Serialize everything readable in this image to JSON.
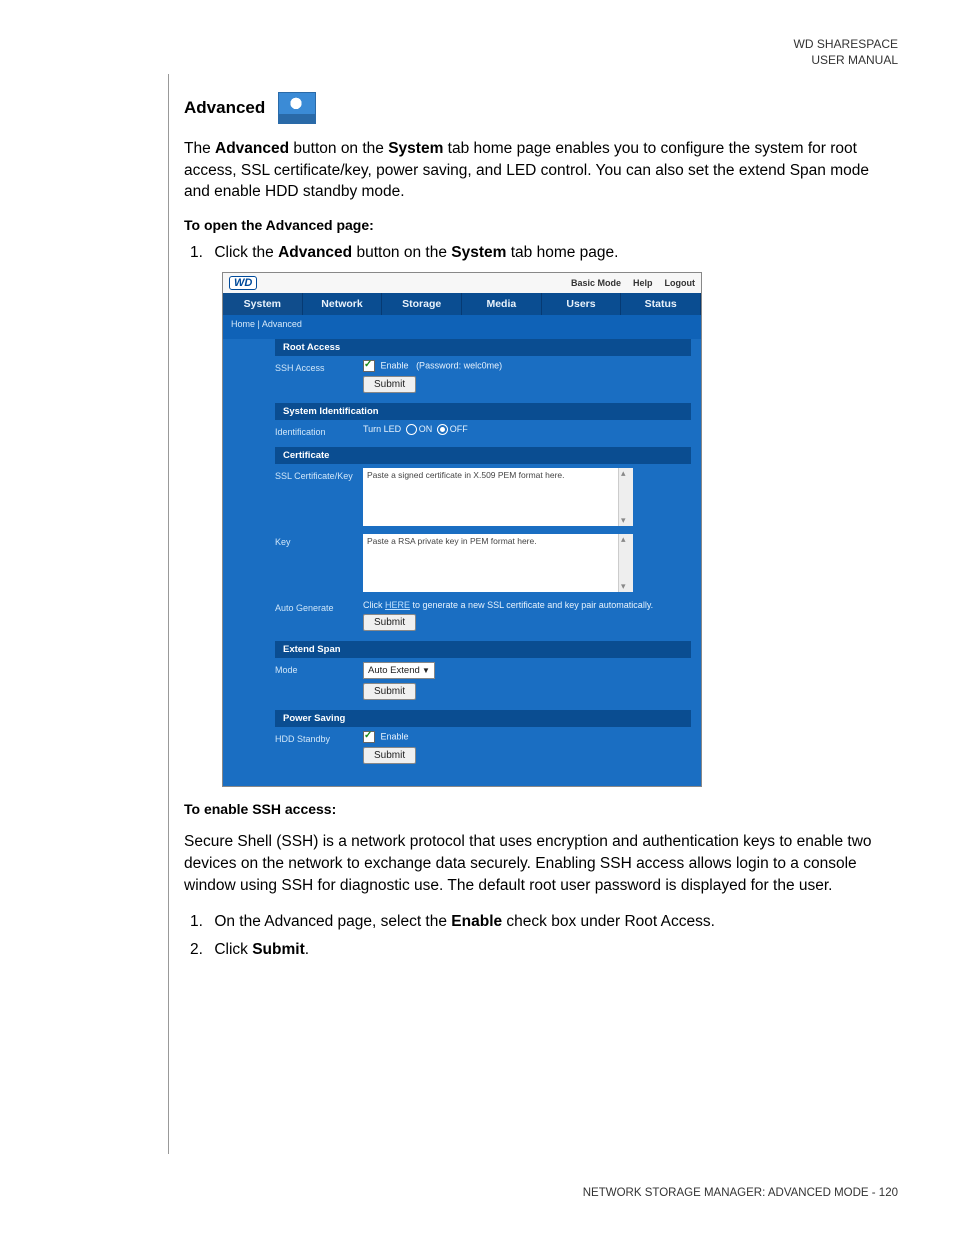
{
  "header": {
    "product": "WD SHARESPACE",
    "doc": "USER MANUAL"
  },
  "title": "Advanced",
  "intro": {
    "pre": "The ",
    "b1": "Advanced",
    "mid1": " button on the ",
    "b2": "System",
    "post": " tab home page enables you to configure the system for root access, SSL certificate/key, power saving, and LED control. You can also set the extend Span mode and enable HDD standby mode."
  },
  "subhead1": "To open the Advanced page:",
  "step1": {
    "pre": "Click the ",
    "b1": "Advanced",
    "mid": " button on the ",
    "b2": "System",
    "post": " tab home page."
  },
  "screenshot": {
    "topbar": {
      "basic": "Basic Mode",
      "help": "Help",
      "logout": "Logout"
    },
    "tabs": [
      "System",
      "Network",
      "Storage",
      "Media",
      "Users",
      "Status"
    ],
    "crumb": "Home | Advanced",
    "sections": {
      "root": {
        "title": "Root Access",
        "row_label": "SSH Access",
        "enable": "Enable",
        "pw": "(Password: welc0me)",
        "submit": "Submit"
      },
      "ident": {
        "title": "System Identification",
        "row_label": "Identification",
        "led": "Turn LED",
        "on": "ON",
        "off": "OFF"
      },
      "cert": {
        "title": "Certificate",
        "ssl_label": "SSL Certificate/Key",
        "ssl_ph": "Paste a signed certificate in X.509 PEM format here.",
        "key_label": "Key",
        "key_ph": "Paste a RSA private key in PEM format here.",
        "auto_label": "Auto Generate",
        "auto_pre": "Click ",
        "auto_link": "HERE",
        "auto_post": " to generate a new SSL certificate and key pair automatically.",
        "submit": "Submit"
      },
      "span": {
        "title": "Extend Span",
        "row_label": "Mode",
        "option": "Auto Extend",
        "submit": "Submit"
      },
      "power": {
        "title": "Power Saving",
        "row_label": "HDD Standby",
        "enable": "Enable",
        "submit": "Submit"
      }
    }
  },
  "subhead2": "To enable SSH access:",
  "ssh_para": "Secure Shell (SSH) is a network protocol that uses encryption and authentication keys to enable two devices on the network to exchange data securely. Enabling SSH access allows login to a console window using SSH for diagnostic use. The default root user password is displayed for the user.",
  "ssh_step1": {
    "pre": "On the Advanced page, select the ",
    "b": "Enable",
    "post": " check box under Root Access."
  },
  "ssh_step2": {
    "pre": "Click ",
    "b": "Submit",
    "post": "."
  },
  "footer": "NETWORK STORAGE MANAGER: ADVANCED MODE - 120"
}
